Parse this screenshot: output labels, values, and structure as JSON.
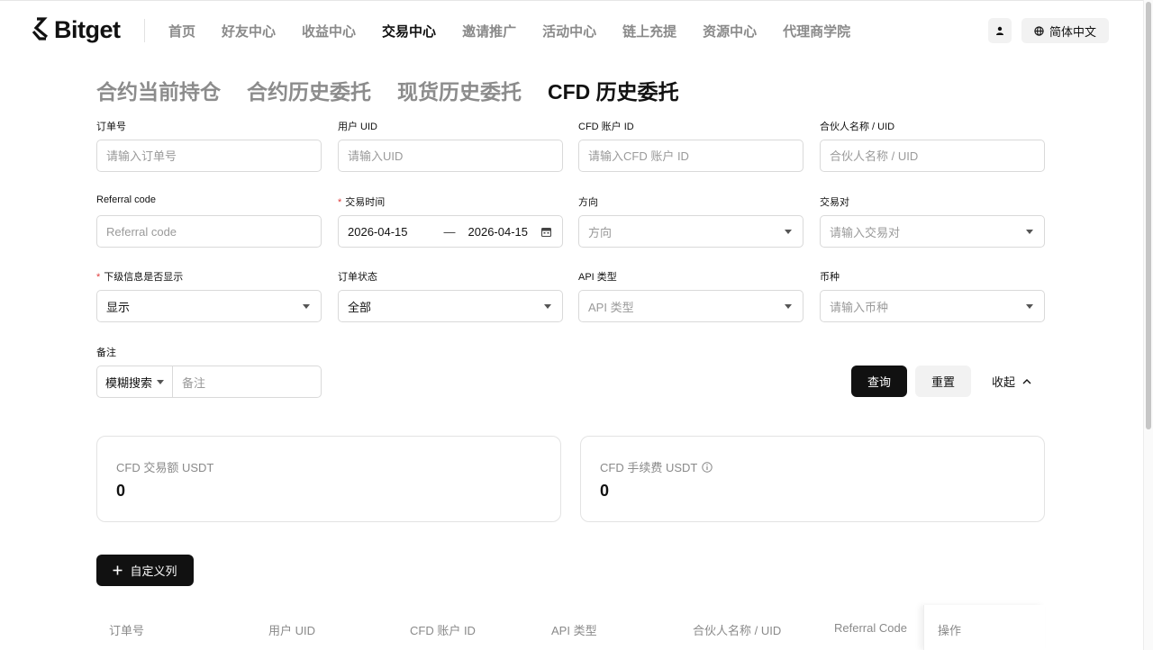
{
  "header": {
    "logo_text": "Bitget",
    "nav": [
      "首页",
      "好友中心",
      "收益中心",
      "交易中心",
      "邀请推广",
      "活动中心",
      "链上充提",
      "资源中心",
      "代理商学院"
    ],
    "active_nav_index": 3,
    "language": "简体中文"
  },
  "tabs": {
    "items": [
      "合约当前持仓",
      "合约历史委托",
      "现货历史委托",
      "CFD 历史委托"
    ],
    "active_index": 3
  },
  "form": {
    "order_no": {
      "label": "订单号",
      "placeholder": "请输入订单号"
    },
    "user_uid": {
      "label": "用户 UID",
      "placeholder": "请输入UID"
    },
    "cfd_account": {
      "label": "CFD 账户 ID",
      "placeholder": "请输入CFD 账户 ID"
    },
    "partner": {
      "label": "合伙人名称 / UID",
      "placeholder": "合伙人名称 / UID"
    },
    "referral": {
      "label": "Referral code",
      "placeholder": "Referral code"
    },
    "trade_time": {
      "label": "交易时间",
      "required_mark": "*",
      "start": "2026-04-15",
      "separator": "—",
      "end": "2026-04-15"
    },
    "direction": {
      "label": "方向",
      "placeholder": "方向"
    },
    "pair": {
      "label": "交易对",
      "placeholder": "请输入交易对"
    },
    "show_sub": {
      "label": "下级信息是否显示",
      "required_mark": "*",
      "value": "显示"
    },
    "order_status": {
      "label": "订单状态",
      "value": "全部"
    },
    "api_type": {
      "label": "API 类型",
      "placeholder": "API 类型"
    },
    "currency": {
      "label": "币种",
      "placeholder": "请输入币种"
    },
    "remark": {
      "label": "备注",
      "mode": "模糊搜索",
      "placeholder": "备注"
    }
  },
  "actions": {
    "query": "查询",
    "reset": "重置",
    "collapse": "收起"
  },
  "stats": [
    {
      "label": "CFD 交易额 USDT",
      "value": "0"
    },
    {
      "label": "CFD 手续费 USDT",
      "value": "0"
    }
  ],
  "custom_columns_label": "自定义列",
  "table": {
    "columns": [
      "订单号",
      "用户 UID",
      "CFD 账户 ID",
      "API 类型",
      "合伙人名称 / UID",
      "Referral Code"
    ],
    "fixed_column": "操作"
  }
}
